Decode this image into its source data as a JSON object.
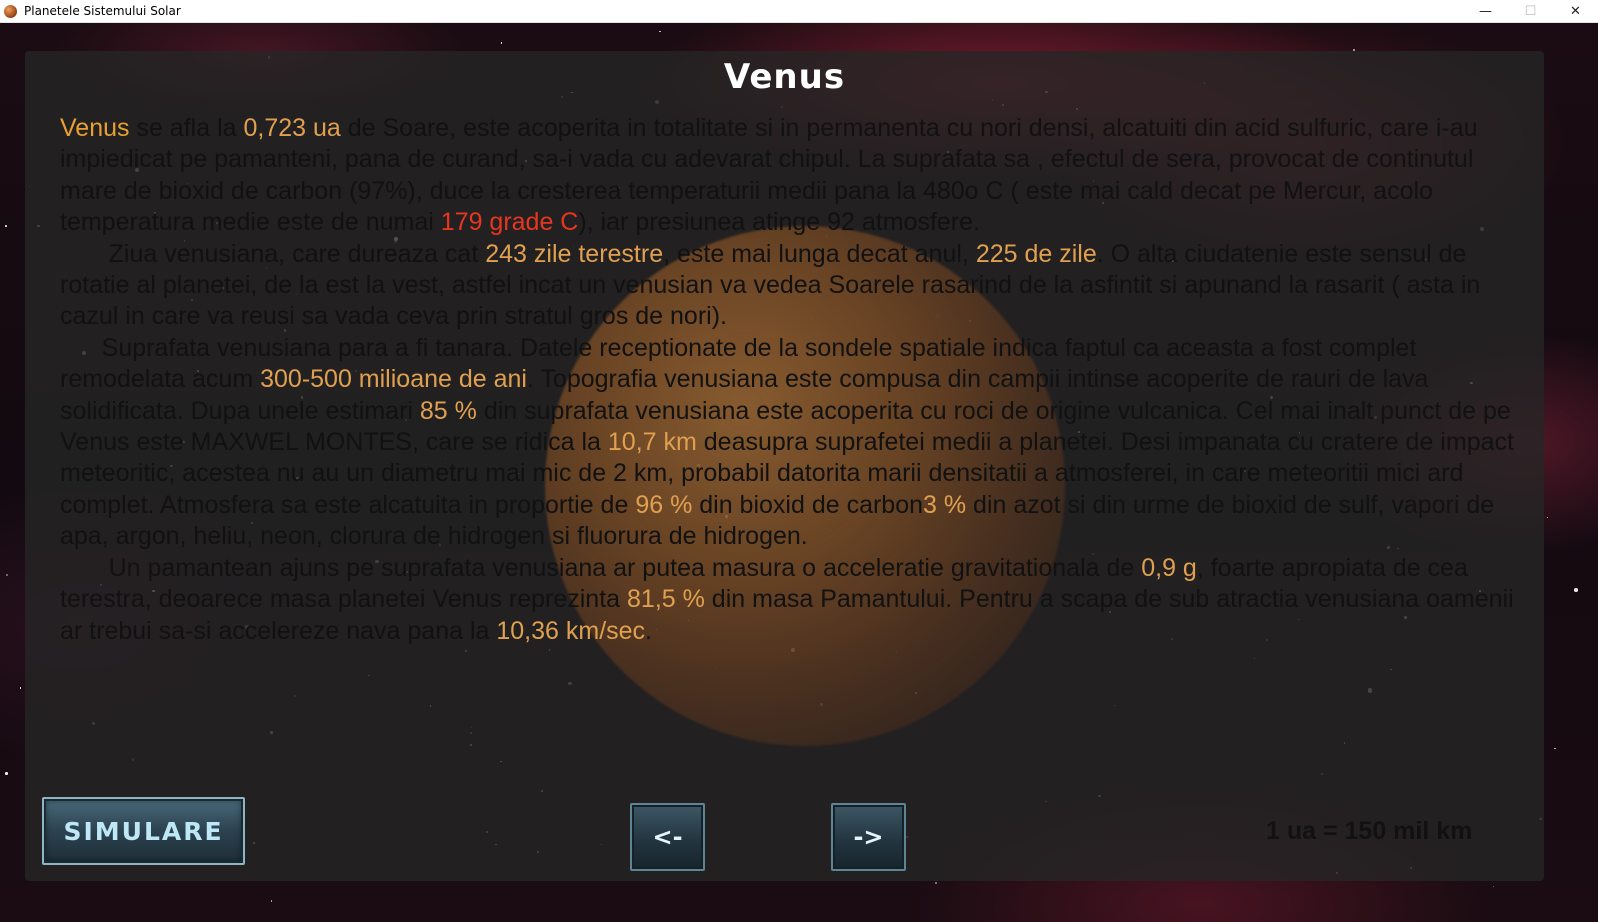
{
  "window": {
    "title": "Planetele Sistemului Solar",
    "minimize": "—",
    "maximize": "☐",
    "close": "✕"
  },
  "planet": {
    "name": "Venus",
    "paragraphs": [
      [
        {
          "t": "Venus",
          "c": "name"
        },
        {
          "t": " se afla la "
        },
        {
          "t": "0,723 ua",
          "c": "hl"
        },
        {
          "t": " de Soare, este acoperita in totalitate si in permanenta cu nori densi, alcatuiti din acid sulfuric, care i-au impiedicat pe pamanteni, pana de curand, sa-i vada cu adevarat chipul. La suprafata sa , efectul de sera, provocat de continutul mare de bioxid de carbon (97%), duce la cresterea temperaturii medii pana la 480o C ( este mai cald decat pe Mercur, acolo temperatura medie este de numai "
        },
        {
          "t": "179 grade C",
          "c": "red"
        },
        {
          "t": "), iar presiunea atinge 92 atmosfere."
        }
      ],
      [
        {
          "t": "       Ziua venusiana, care dureaza cat "
        },
        {
          "t": "243 zile terestre",
          "c": "hl"
        },
        {
          "t": ", este mai lunga decat anul, "
        },
        {
          "t": "225 de zile",
          "c": "hl"
        },
        {
          "t": ". O alta ciudatenie este sensul de rotatie al planetei, de la est la vest, astfel incat un venusian va vedea Soarele rasarind de la asfintit si apunand la rasarit ( asta in cazul in care va reusi sa vada ceva prin stratul gros de nori)."
        }
      ],
      [
        {
          "t": "      Suprafata venusiana para a fi tanara. Datele receptionate de la sondele spatiale indica faptul ca aceasta a fost complet remodelata acum "
        },
        {
          "t": "300-500 milioane de ani",
          "c": "hl"
        },
        {
          "t": ". Topografia venusiana este compusa din campii intinse acoperite de rauri de lava solidificata. Dupa unele estimari "
        },
        {
          "t": "85 %",
          "c": "hl"
        },
        {
          "t": " din suprafata venusiana este acoperita cu roci de origine vulcanica. Cel mai inalt punct de pe Venus este MAXWEL MONTES, care se ridica la "
        },
        {
          "t": "10,7 km",
          "c": "hl"
        },
        {
          "t": "  deasupra suprafetei medii a planetei. Desi impanata cu cratere de impact meteoritic, acestea nu au un diametru mai mic de 2 km, probabil datorita marii densitatii a atmosferei, in care meteoritii mici ard complet. Atmosfera sa este alcatuita in proportie de "
        },
        {
          "t": "96 %",
          "c": "hl"
        },
        {
          "t": "  din bioxid de carbon"
        },
        {
          "t": "3 %",
          "c": "hl"
        },
        {
          "t": "  din azot si din urme de bioxid de sulf, vapori de apa, argon, heliu, neon, clorura de hidrogen si fluorura de hidrogen."
        }
      ],
      [
        {
          "t": "       Un pamantean ajuns pe suprafata venusiana ar putea masura o acceleratie gravitationala de "
        },
        {
          "t": "0,9 g",
          "c": "hl"
        },
        {
          "t": ", foarte apropiata de cea terestra, deoarece masa planetei Venus reprezinta "
        },
        {
          "t": "81,5 %",
          "c": "hl"
        },
        {
          "t": "  din masa Pamantului. Pentru a scapa de sub atractia venusiana oamenii ar trebui sa-si accelereze nava pana la "
        },
        {
          "t": "10,36 km/sec",
          "c": "hl"
        },
        {
          "t": "."
        }
      ]
    ]
  },
  "buttons": {
    "simulate": "SIMULARE",
    "prev": "<-",
    "next": "->"
  },
  "scale_note": "1 ua = 150 mil km",
  "colors": {
    "highlight": "#e0a050",
    "name": "#e8a030",
    "red": "#e8361e",
    "button_text": "#bfe8f6"
  }
}
